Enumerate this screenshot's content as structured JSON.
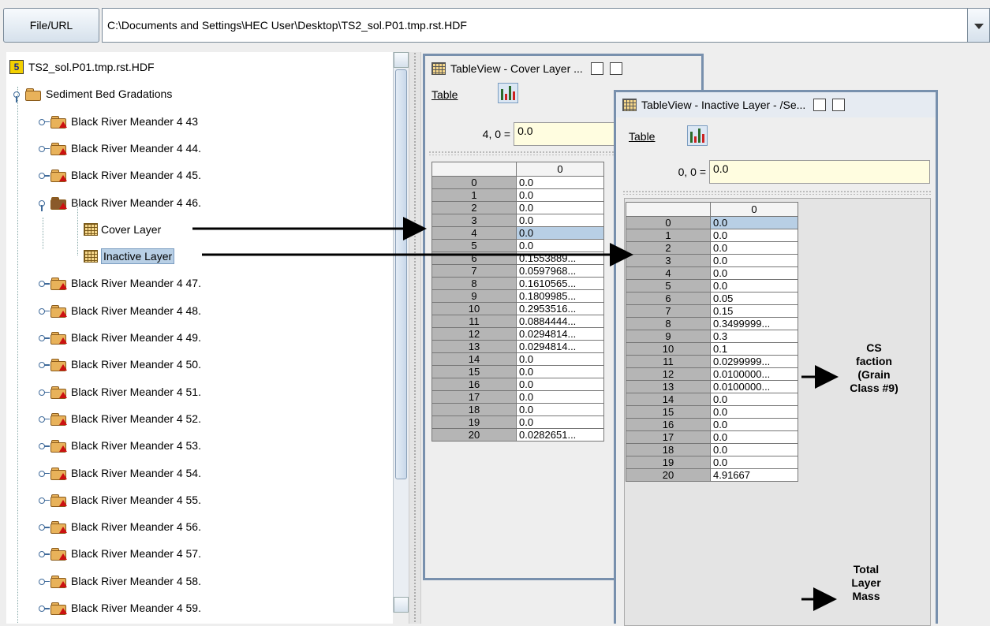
{
  "toolbar": {
    "file_button": "File/URL",
    "path_value": "C:\\Documents and Settings\\HEC User\\Desktop\\TS2_sol.P01.tmp.rst.HDF"
  },
  "tree": {
    "root": "TS2_sol.P01.tmp.rst.HDF",
    "group": "Sediment Bed Gradations",
    "items_before": [
      "Black River Meander 4 43",
      "Black River Meander 4 44.",
      "Black River Meander 4 45."
    ],
    "expanded_item": "Black River Meander 4 46.",
    "children": [
      "Cover Layer",
      "Inactive Layer"
    ],
    "items_after": [
      "Black River Meander 4 47.",
      "Black River Meander 4 48.",
      "Black River Meander 4 49.",
      "Black River Meander 4 50.",
      "Black River Meander 4 51.",
      "Black River Meander 4 52.",
      "Black River Meander 4 53.",
      "Black River Meander 4 54.",
      "Black River Meander 4 55.",
      "Black River Meander 4 56.",
      "Black River Meander 4 57.",
      "Black River Meander 4 58.",
      "Black River Meander 4 59."
    ]
  },
  "cover_view": {
    "title": "TableView  -  Cover Layer  ...",
    "menu": "Table",
    "cell_ref": "4, 0  =",
    "cell_value": "0.0",
    "column_header": "0",
    "rows": [
      "0",
      "1",
      "2",
      "3",
      "4",
      "5",
      "6",
      "7",
      "8",
      "9",
      "10",
      "11",
      "12",
      "13",
      "14",
      "15",
      "16",
      "17",
      "18",
      "19",
      "20"
    ],
    "values": [
      "0.0",
      "0.0",
      "0.0",
      "0.0",
      "0.0",
      "0.0",
      "0.1553889...",
      "0.0597968...",
      "0.1610565...",
      "0.1809985...",
      "0.2953516...",
      "0.0884444...",
      "0.0294814...",
      "0.0294814...",
      "0.0",
      "0.0",
      "0.0",
      "0.0",
      "0.0",
      "0.0",
      "0.0282651..."
    ]
  },
  "inactive_view": {
    "title": "TableView  -  Inactive Layer  -  /Se...",
    "menu": "Table",
    "cell_ref": "0, 0  =",
    "cell_value": "0.0",
    "column_header": "0",
    "rows": [
      "0",
      "1",
      "2",
      "3",
      "4",
      "5",
      "6",
      "7",
      "8",
      "9",
      "10",
      "11",
      "12",
      "13",
      "14",
      "15",
      "16",
      "17",
      "18",
      "19",
      "20"
    ],
    "values": [
      "0.0",
      "0.0",
      "0.0",
      "0.0",
      "0.0",
      "0.0",
      "0.05",
      "0.15",
      "0.3499999...",
      "0.3",
      "0.1",
      "0.0299999...",
      "0.0100000...",
      "0.0100000...",
      "0.0",
      "0.0",
      "0.0",
      "0.0",
      "0.0",
      "0.0",
      "4.91667"
    ]
  },
  "annotations": {
    "cs_fraction": [
      "CS",
      "faction",
      "(Grain",
      "Class #9)"
    ],
    "total_mass": [
      "Total",
      "Layer",
      "Mass"
    ]
  },
  "colors": {
    "selection": "#b8cfe5",
    "frame_border": "#7890ad",
    "row_header": "#b5b5b5"
  }
}
